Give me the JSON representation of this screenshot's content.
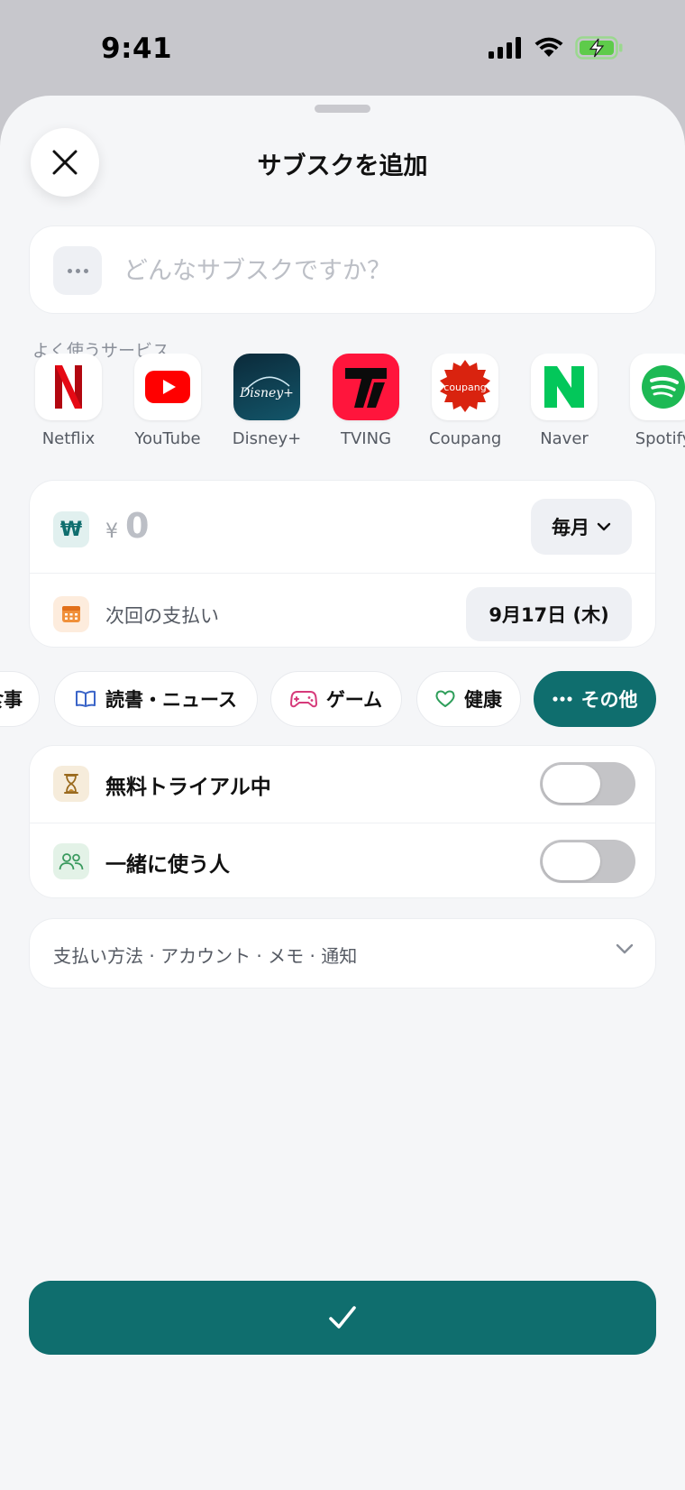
{
  "status_bar": {
    "time": "9:41"
  },
  "sheet": {
    "title": "サブスクを追加"
  },
  "name_field": {
    "placeholder": "どんなサブスクですか？"
  },
  "popular": {
    "label": "よく使うサービス",
    "items": [
      {
        "label": "Netflix",
        "icon": "netflix-logo",
        "color": "#e50914"
      },
      {
        "label": "YouTube",
        "icon": "youtube-logo",
        "color": "#ff0000"
      },
      {
        "label": "Disney+",
        "icon": "disney-plus-logo",
        "color": "#0e3b4a"
      },
      {
        "label": "TVING",
        "icon": "tving-logo",
        "color": "#ff153c"
      },
      {
        "label": "Coupang",
        "icon": "coupang-logo",
        "color": "#d9230f"
      },
      {
        "label": "Naver",
        "icon": "naver-logo",
        "color": "#03c75a"
      },
      {
        "label": "Spotify",
        "icon": "spotify-logo",
        "color": "#1db954"
      }
    ]
  },
  "price": {
    "currency_symbol": "₩",
    "yen_prefix": "¥",
    "amount": "0",
    "cycle": "毎月"
  },
  "next_payment": {
    "label": "次回の支払い",
    "date": "9月17日 (木)"
  },
  "categories": [
    {
      "label": "食事",
      "icon": "none",
      "active": false
    },
    {
      "label": "読書・ニュース",
      "icon": "book-icon",
      "active": false
    },
    {
      "label": "ゲーム",
      "icon": "gamepad-icon",
      "active": false
    },
    {
      "label": "健康",
      "icon": "heart-icon",
      "active": false
    },
    {
      "label": "その他",
      "icon": "more-dots-icon",
      "active": true
    }
  ],
  "toggles": [
    {
      "label": "無料トライアル中",
      "on": false
    },
    {
      "label": "一緒に使う人",
      "on": false
    }
  ],
  "more_options": {
    "label": "支払い方法 · アカウント · メモ · 通知"
  },
  "colors": {
    "accent": "#0f6e6e",
    "background": "#f5f6f8"
  }
}
